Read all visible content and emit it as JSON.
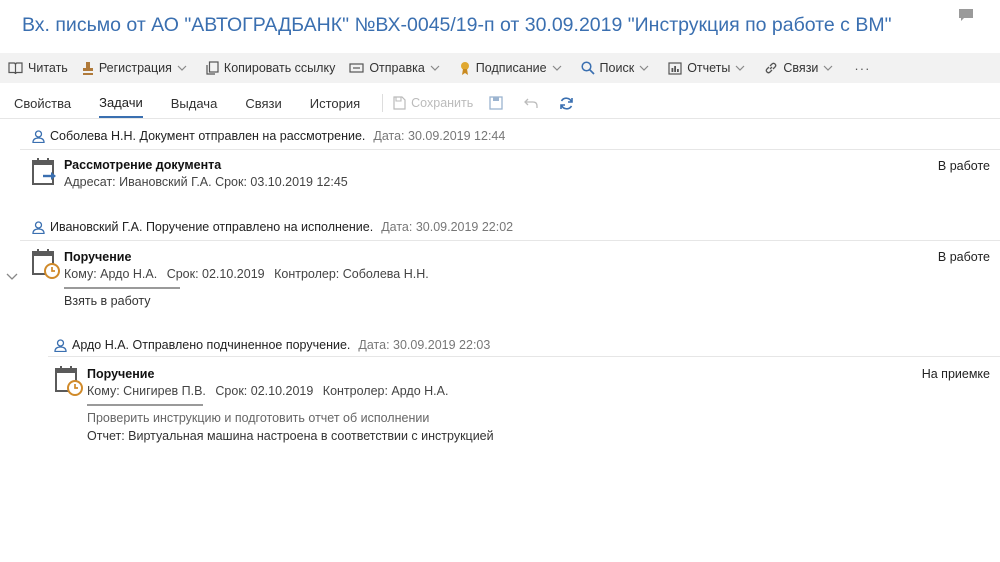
{
  "window": {
    "title": "Вх. письмо от АО \"АВТОГРАДБАНК\" №ВХ-0045/19-п от 30.09.2019 \"Инструкция по работе с ВМ\""
  },
  "toolbar": {
    "read": "Читать",
    "registration": "Регистрация",
    "copy_link": "Копировать ссылку",
    "send": "Отправка",
    "sign": "Подписание",
    "search": "Поиск",
    "reports": "Отчеты",
    "links": "Связи",
    "more": "···"
  },
  "tabs": {
    "properties": "Свойства",
    "tasks": "Задачи",
    "issue": "Выдача",
    "links": "Связи",
    "history": "История",
    "save": "Сохранить"
  },
  "events": [
    {
      "author": "Соболева Н.Н. Документ отправлен на рассмотрение.",
      "date": "Дата: 30.09.2019 12:44",
      "task": {
        "title": "Рассмотрение документа",
        "meta": "Адресат: Ивановский Г.А. Срок: 03.10.2019 12:45",
        "status": "В работе"
      }
    },
    {
      "author": "Ивановский Г.А. Поручение отправлено на исполнение.",
      "date": "Дата: 30.09.2019 22:02",
      "task": {
        "title": "Поручение",
        "to": "Кому: Ардо Н.А.",
        "due": "Срок: 02.10.2019",
        "controller": "Контролер: Соболева Н.Н.",
        "status": "В работе",
        "action": "Взять в работу"
      }
    },
    {
      "author": "Ардо Н.А. Отправлено подчиненное поручение.",
      "date": "Дата: 30.09.2019 22:03",
      "task": {
        "title": "Поручение",
        "to": "Кому: Снигирев П.В.",
        "due": "Срок: 02.10.2019",
        "controller": "Контролер: Ардо Н.А.",
        "status": "На приемке",
        "instruction": "Проверить инструкцию и подготовить отчет об исполнении",
        "report": "Отчет: Виртуальная машина настроена в соответствии с инструкцией"
      }
    }
  ],
  "colors": {
    "accent": "#3a6fb0",
    "icon_gray": "#5a5a5a",
    "clock": "#d08a2a"
  }
}
